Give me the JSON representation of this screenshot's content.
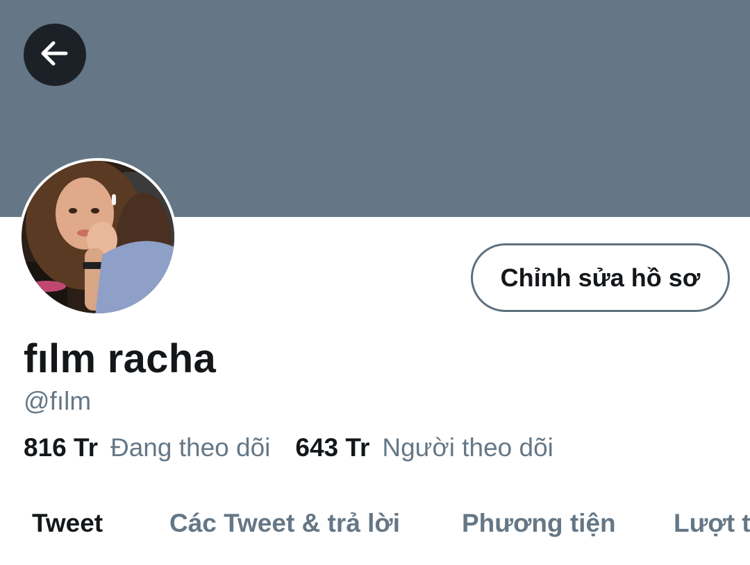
{
  "profile": {
    "display_name": "fılm racha",
    "handle": "@fılm",
    "edit_button_label": "Chỉnh sửa hồ sơ"
  },
  "stats": {
    "following_count": "816 Tr",
    "following_label": "Đang theo dõi",
    "followers_count": "643 Tr",
    "followers_label": "Người theo dõi"
  },
  "tabs": [
    {
      "label": "Tweet",
      "active": true
    },
    {
      "label": "Các Tweet & trả lời",
      "active": false
    },
    {
      "label": "Phương tiện",
      "active": false
    },
    {
      "label": "Lượt thích",
      "active": false
    }
  ],
  "icons": {
    "back": "arrow-left-icon"
  },
  "colors": {
    "banner": "#657786",
    "primary_text": "#14171a",
    "secondary_text": "#657786",
    "back_button_bg": "#1b2127",
    "edit_button_border": "#5f6f7c"
  }
}
